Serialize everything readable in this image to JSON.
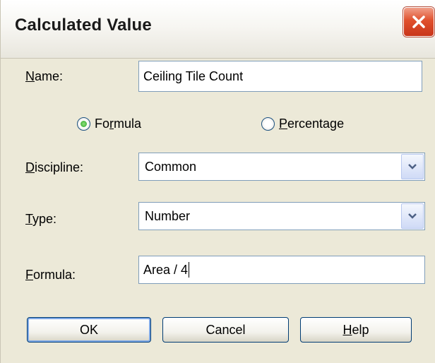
{
  "window": {
    "title": "Calculated Value"
  },
  "name": {
    "label_prefix": "",
    "label_mnemonic": "N",
    "label_rest": "ame:",
    "value": "Ceiling Tile Count"
  },
  "mode": {
    "formula": {
      "mnemonic_prefix": "Fo",
      "mnemonic": "r",
      "rest": "mula",
      "checked": true
    },
    "percentage": {
      "mnemonic_prefix": "",
      "mnemonic": "P",
      "rest": "ercentage",
      "checked": false
    }
  },
  "discipline": {
    "label_mnemonic": "D",
    "label_rest": "iscipline:",
    "selected": "Common"
  },
  "type": {
    "label_mnemonic": "T",
    "label_rest": "ype:",
    "selected": "Number"
  },
  "formula": {
    "label_mnemonic": "F",
    "label_rest": "ormula:",
    "value": "Area / 4"
  },
  "buttons": {
    "ok": "OK",
    "cancel": "Cancel",
    "help_mnemonic": "H",
    "help_rest": "elp"
  }
}
